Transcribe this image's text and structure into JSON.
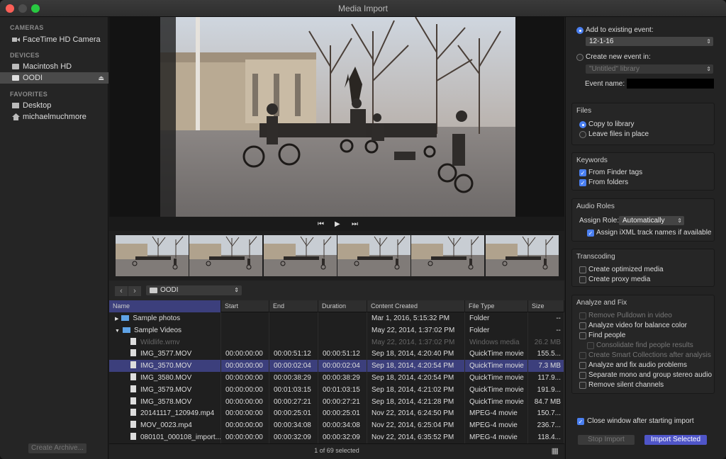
{
  "window": {
    "title": "Media Import"
  },
  "sidebar": {
    "cameras_header": "CAMERAS",
    "camera": "FaceTime HD Camera",
    "devices_header": "DEVICES",
    "device1": "Macintosh HD",
    "device2": "OODI",
    "favorites_header": "FAVORITES",
    "fav1": "Desktop",
    "fav2": "michaelmuchmore",
    "create_archive": "Create Archive..."
  },
  "browser": {
    "path": "OODI",
    "columns": [
      "Name",
      "Start",
      "End",
      "Duration",
      "Content Created",
      "File Type",
      "Size"
    ],
    "rows": [
      {
        "name": "Sample photos",
        "start": "",
        "end": "",
        "duration": "",
        "created": "Mar 1, 2016, 5:15:32 PM",
        "type": "Folder",
        "size": "--"
      },
      {
        "name": "Sample Videos",
        "start": "",
        "end": "",
        "duration": "",
        "created": "May 22, 2014, 1:37:02 PM",
        "type": "Folder",
        "size": "--"
      },
      {
        "name": "Wildlife.wmv",
        "start": "",
        "end": "",
        "duration": "",
        "created": "May 22, 2014, 1:37:02 PM",
        "type": "Windows media",
        "size": "26.2 MB"
      },
      {
        "name": "IMG_3577.MOV",
        "start": "00:00:00:00",
        "end": "00:00:51:12",
        "duration": "00:00:51:12",
        "created": "Sep 18, 2014, 4:20:40 PM",
        "type": "QuickTime movie",
        "size": "155.5..."
      },
      {
        "name": "IMG_3570.MOV",
        "start": "00:00:00:00",
        "end": "00:00:02:04",
        "duration": "00:00:02:04",
        "created": "Sep 18, 2014, 4:20:54 PM",
        "type": "QuickTime movie",
        "size": "7.3 MB"
      },
      {
        "name": "IMG_3580.MOV",
        "start": "00:00:00:00",
        "end": "00:00:38:29",
        "duration": "00:00:38:29",
        "created": "Sep 18, 2014, 4:20:54 PM",
        "type": "QuickTime movie",
        "size": "117.9..."
      },
      {
        "name": "IMG_3579.MOV",
        "start": "00:00:00:00",
        "end": "00:01:03:15",
        "duration": "00:01:03:15",
        "created": "Sep 18, 2014, 4:21:02 PM",
        "type": "QuickTime movie",
        "size": "191.9..."
      },
      {
        "name": "IMG_3578.MOV",
        "start": "00:00:00:00",
        "end": "00:00:27:21",
        "duration": "00:00:27:21",
        "created": "Sep 18, 2014, 4:21:28 PM",
        "type": "QuickTime movie",
        "size": "84.7 MB"
      },
      {
        "name": "20141117_120949.mp4",
        "start": "00:00:00:00",
        "end": "00:00:25:01",
        "duration": "00:00:25:01",
        "created": "Nov 22, 2014, 6:24:50 PM",
        "type": "MPEG-4 movie",
        "size": "150.7..."
      },
      {
        "name": "MOV_0023.mp4",
        "start": "00:00:00:00",
        "end": "00:00:34:08",
        "duration": "00:00:34:08",
        "created": "Nov 22, 2014, 6:25:04 PM",
        "type": "MPEG-4 movie",
        "size": "236.7..."
      },
      {
        "name": "080101_000108_import...",
        "start": "00:00:00:00",
        "end": "00:00:32:09",
        "duration": "00:00:32:09",
        "created": "Nov 22, 2014, 6:35:52 PM",
        "type": "MPEG-4 movie",
        "size": "118.4..."
      }
    ],
    "status": "1 of 69 selected"
  },
  "options": {
    "add_existing": "Add to existing event:",
    "event_value": "12-1-16",
    "create_new": "Create new event in:",
    "library_value": "\"Untitled\" library",
    "event_name_label": "Event name:",
    "files_title": "Files",
    "copy_library": "Copy to library",
    "leave_files": "Leave files in place",
    "keywords_title": "Keywords",
    "from_finder": "From Finder tags",
    "from_folders": "From folders",
    "audio_title": "Audio Roles",
    "assign_role": "Assign Role:",
    "role_value": "Automatically",
    "assign_ixml": "Assign iXML track names if available",
    "transcoding_title": "Transcoding",
    "optimized": "Create optimized media",
    "proxy": "Create proxy media",
    "analyze_title": "Analyze and Fix",
    "pulldown": "Remove Pulldown in video",
    "balance": "Analyze video for balance color",
    "find_people": "Find people",
    "consolidate": "Consolidate find people results",
    "smart": "Create Smart Collections after analysis",
    "audio_problems": "Analyze and fix audio problems",
    "mono": "Separate mono and group stereo audio",
    "silent": "Remove silent channels",
    "close_after": "Close window after starting import",
    "stop_import": "Stop Import",
    "import_selected": "Import Selected"
  }
}
